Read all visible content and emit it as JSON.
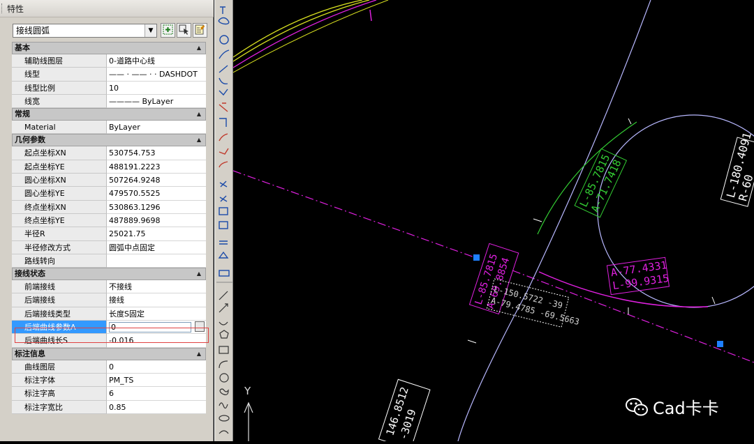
{
  "panel": {
    "title": "特性",
    "object_type": "接线圆弧",
    "sections": [
      {
        "name": "基本",
        "rows": [
          {
            "label": "辅助线图层",
            "value": "0-道路中心线"
          },
          {
            "label": "线型",
            "value": "—— · —— · · DASHDOT"
          },
          {
            "label": "线型比例",
            "value": "10"
          },
          {
            "label": "线宽",
            "value": "———— ByLayer"
          }
        ]
      },
      {
        "name": "常规",
        "rows": [
          {
            "label": "Material",
            "value": "ByLayer"
          }
        ]
      },
      {
        "name": "几何参数",
        "rows": [
          {
            "label": "起点坐标XN",
            "value": "530754.753"
          },
          {
            "label": "起点坐标YE",
            "value": "488191.2223"
          },
          {
            "label": "圆心坐标XN",
            "value": "507264.9248"
          },
          {
            "label": "圆心坐标YE",
            "value": "479570.5525"
          },
          {
            "label": "终点坐标XN",
            "value": "530863.1296"
          },
          {
            "label": "终点坐标YE",
            "value": "487889.9698"
          },
          {
            "label": "半径R",
            "value": "25021.75"
          },
          {
            "label": "半径修改方式",
            "value": "圆弧中点固定"
          },
          {
            "label": "路线转向",
            "value": ""
          }
        ]
      },
      {
        "name": "接线状态",
        "rows": [
          {
            "label": "前端接线",
            "value": "不接线"
          },
          {
            "label": "后端接线",
            "value": "接线"
          },
          {
            "label": "后端接线类型",
            "value": "长度S固定"
          },
          {
            "label": "后端曲线参数A",
            "value": "0",
            "selected": true
          },
          {
            "label": "后端曲线长S",
            "value": "-0.016"
          }
        ]
      },
      {
        "name": "标注信息",
        "rows": [
          {
            "label": "曲线图层",
            "value": "0"
          },
          {
            "label": "标注字体",
            "value": "PM_TS"
          },
          {
            "label": "标注字高",
            "value": "6"
          },
          {
            "label": "标注字宽比",
            "value": "0.85"
          }
        ]
      }
    ]
  },
  "canvas": {
    "labels": {
      "circle_box_1": "L-180.4091",
      "circle_box_2": "R-60",
      "green_box_1": "L-85.7815",
      "green_box_2": "A-71.7418",
      "magenta_box_1": "A-77.4331",
      "magenta_box_2": "L-99.9315",
      "left_box_1": "L-85.7815",
      "left_box_2": "A-69.8854",
      "dotted_box_1": "L-150.5722 -39",
      "dotted_box_2": "A-79.4785 -69.5663",
      "bottom_box_1": "146.8512",
      "bottom_box_2": "-3019",
      "ucs_y": "Y"
    },
    "colors": {
      "background": "#000000",
      "green": "#33cc33",
      "magenta": "#e020e0",
      "lavender": "#b8b8ff",
      "white": "#ffffff",
      "yellow": "#d8e020",
      "grip": "#1e7fff"
    }
  },
  "watermark": {
    "text": "Cad卡卡"
  }
}
